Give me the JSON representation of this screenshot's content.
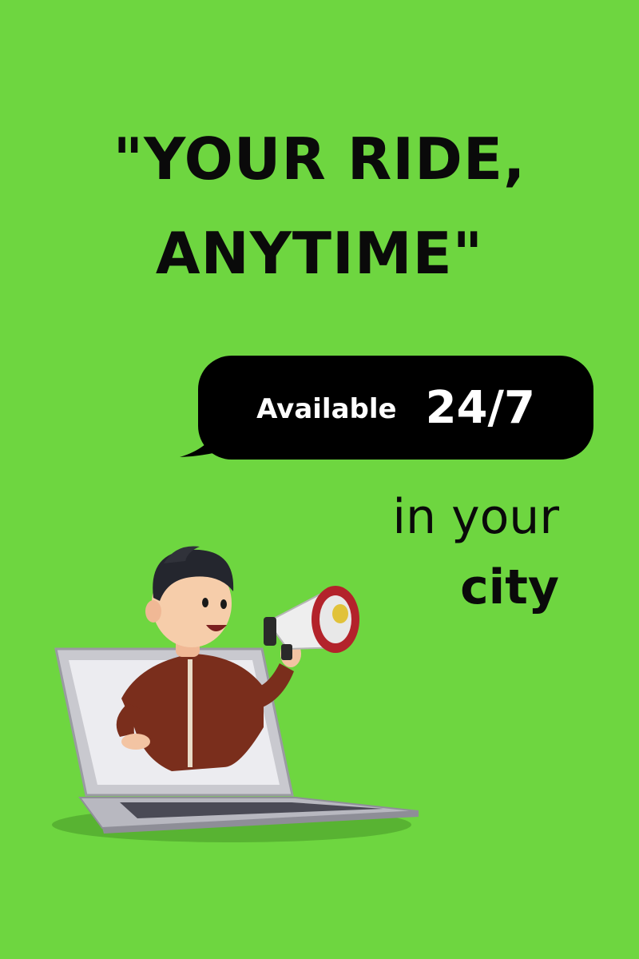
{
  "headline": {
    "line1": "\"YOUR RIDE,",
    "line2": "ANYTIME\""
  },
  "bubble": {
    "label": "Available",
    "hours": "24/7"
  },
  "tagline": {
    "line1": "in your",
    "line2": "city"
  },
  "colors": {
    "background": "#6ed640",
    "text": "#0a0a0a",
    "bubble": "#000000",
    "bubble_text": "#ffffff"
  },
  "illustration": {
    "icons": [
      "person-icon",
      "megaphone-icon",
      "laptop-icon"
    ]
  }
}
